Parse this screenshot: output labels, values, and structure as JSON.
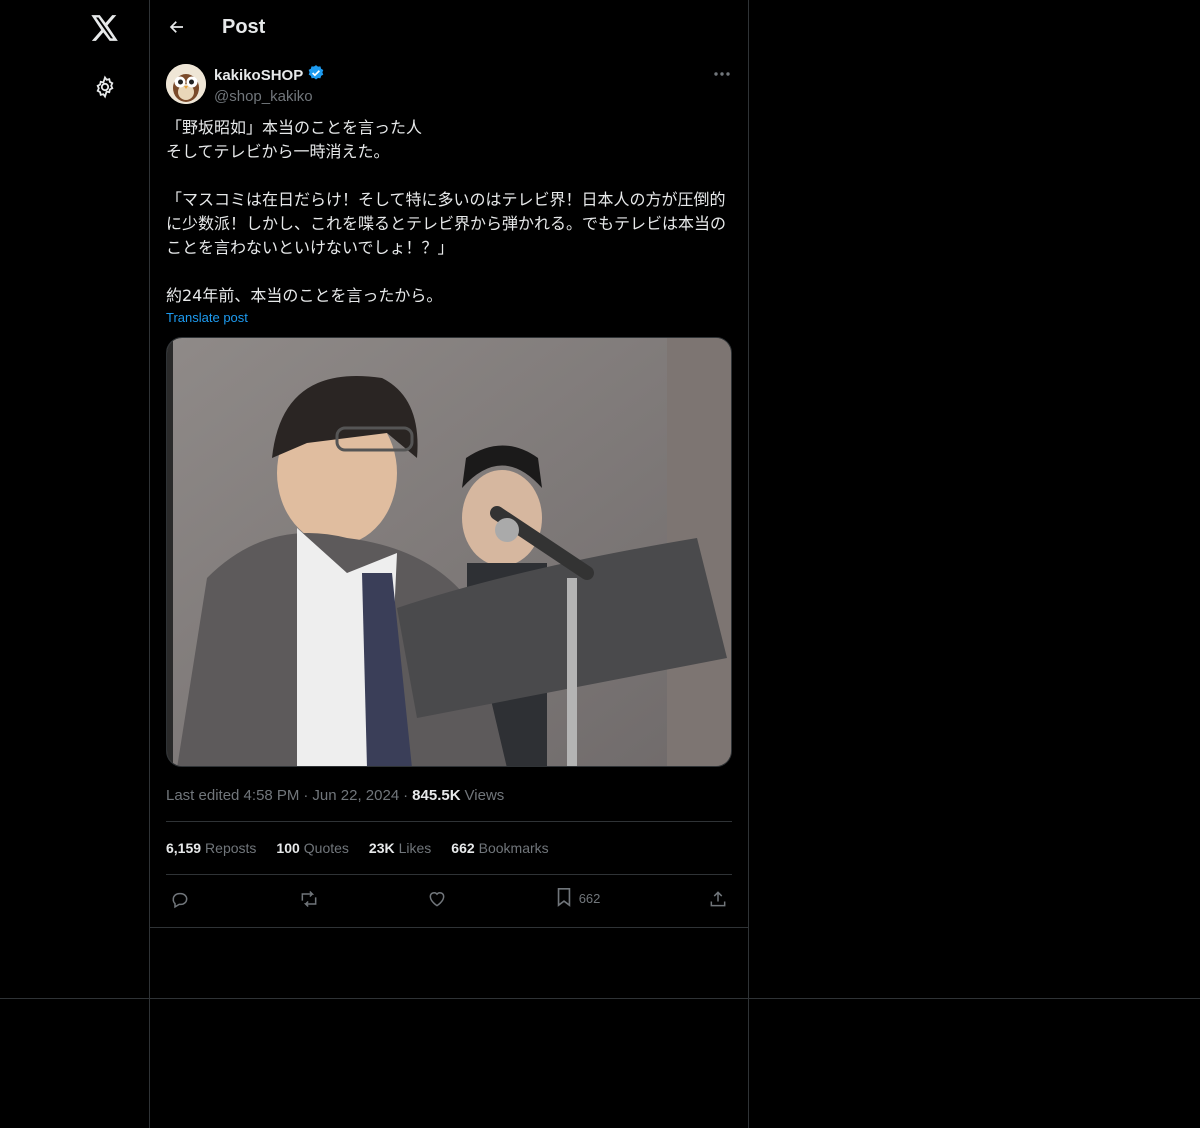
{
  "header": {
    "title": "Post"
  },
  "author": {
    "display_name": "kakikoSHOP",
    "handle": "@shop_kakiko",
    "verified": true
  },
  "post": {
    "text": "「野坂昭如」本当のことを言った人\nそしてテレビから一時消えた。\n\n「マスコミは在日だらけ！そして特に多いのはテレビ界！日本人の方が圧倒的に少数派！しかし、これを喋るとテレビ界から弾かれる。でもテレビは本当のことを言わないといけないでしょ！？」\n\n約24年前、本当のことを言ったから。",
    "translate_label": "Translate post"
  },
  "meta": {
    "edited": "Last edited 4:58 PM",
    "separator": "·",
    "date": "Jun 22, 2024",
    "views_count": "845.5K",
    "views_label": "Views"
  },
  "stats": [
    {
      "count": "6,159",
      "label": "Reposts"
    },
    {
      "count": "100",
      "label": "Quotes"
    },
    {
      "count": "23K",
      "label": "Likes"
    },
    {
      "count": "662",
      "label": "Bookmarks"
    }
  ],
  "actions": {
    "bookmark_count": "662"
  },
  "icons": {
    "logo": "x-logo-icon",
    "settings": "gear-icon",
    "back": "arrow-left-icon",
    "verified": "verified-badge-icon",
    "more": "more-horizontal-icon",
    "reply": "reply-icon",
    "repost": "repost-icon",
    "like": "heart-icon",
    "bookmark": "bookmark-icon",
    "share": "share-icon"
  },
  "colors": {
    "background": "#000000",
    "text": "#e7e9ea",
    "muted": "#71767b",
    "accent": "#1d9bf0",
    "border": "#2f3336"
  }
}
